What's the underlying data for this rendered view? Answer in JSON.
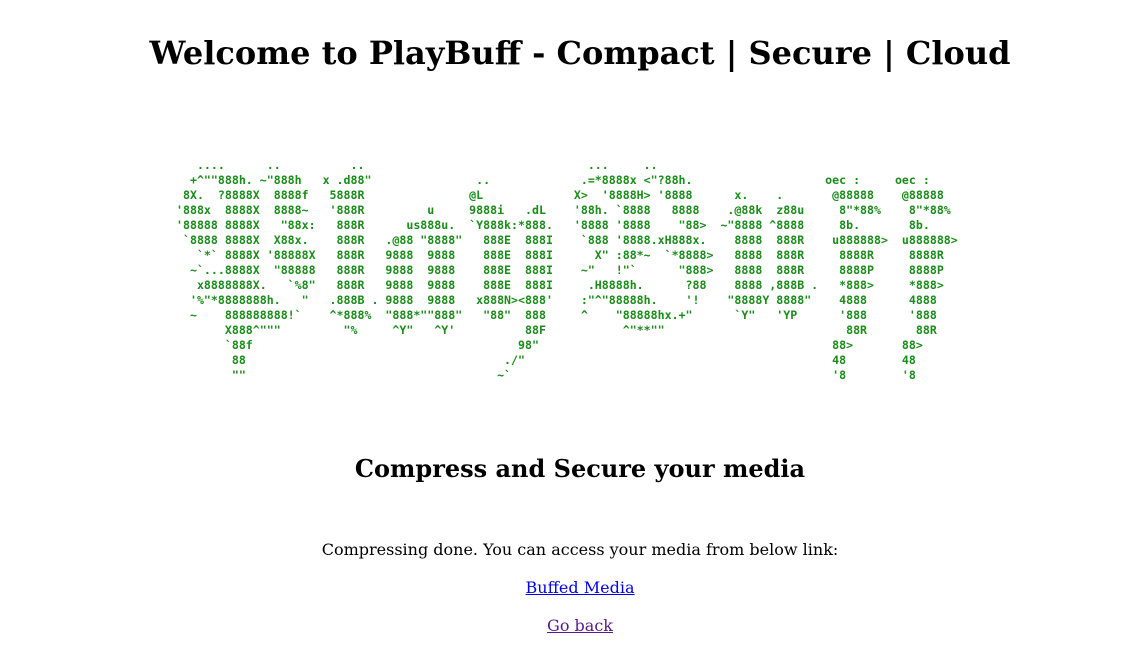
{
  "header": {
    "title": "Welcome to PlayBuff - Compact | Secure | Cloud"
  },
  "banner": {
    "ascii_art": "   ....      ..          ..                                ...     ..\n  +^\"\"888h. ~\"888h   x .d88\"               ..             .=*8888x <\"?88h.                   oec :     oec :\n 8X.  ?8888X  8888f   5888R               @L             X>  '8888H> '8888      x.    .       @88888    @88888\n'888x  8888X  8888~   '888R         u     9888i   .dL    '88h. `8888   8888    .@88k  z88u     8\"*88%    8\"*88%\n'88888 8888X   \"88x:   888R      us888u.  `Y888k:*888.   '8888 '8888    \"88>  ~\"8888 ^8888     8b.       8b.\n `8888 8888X  X88x.    888R   .@88 \"8888\"   888E  888I    `888 '8888.xH888x.    8888  888R    u888888>  u888888>\n   `*` 8888X '88888X   888R   9888  9888    888E  888I      X\" :88*~  `*8888>   8888  888R     8888R     8888R\n  ~`...8888X  \"88888   888R   9888  9888    888E  888I    ~\"   !\"`      \"888>   8888  888R     8888P     8888P\n   x8888888X.   `%8\"   888R   9888  9888    888E  888I     .H8888h.      ?88    8888 ,888B .   *888>     *888>\n  '%\"*8888888h.   \"   .888B . 9888  9888   x888N><888'    :\"^\"88888h.    '!    \"8888Y 8888\"    4888      4888\n  ~    888888888!`    ^*888%  \"888*\"\"888\"   \"88\"  888     ^    \"88888hx.+\"      `Y\"   'YP      '888      '888\n       X888^\"\"\"         \"%     ^Y\"   ^Y'          88F           ^\"**\"\"                          88R       88R\n       `88f                                      98\"                                          88>       88>\n        88                                     ./\"                                            48        48\n        \"\"                                    ~`                                              '8        '8"
  },
  "main": {
    "heading": "Compress and Secure your media",
    "status": "Compressing done. You can access your media from below link:",
    "media_link": "Buffed Media",
    "back_link": "Go back"
  },
  "colors": {
    "ascii_art": "#1a8c1a",
    "link": "#0000ee",
    "visited_link": "#551a8b"
  }
}
